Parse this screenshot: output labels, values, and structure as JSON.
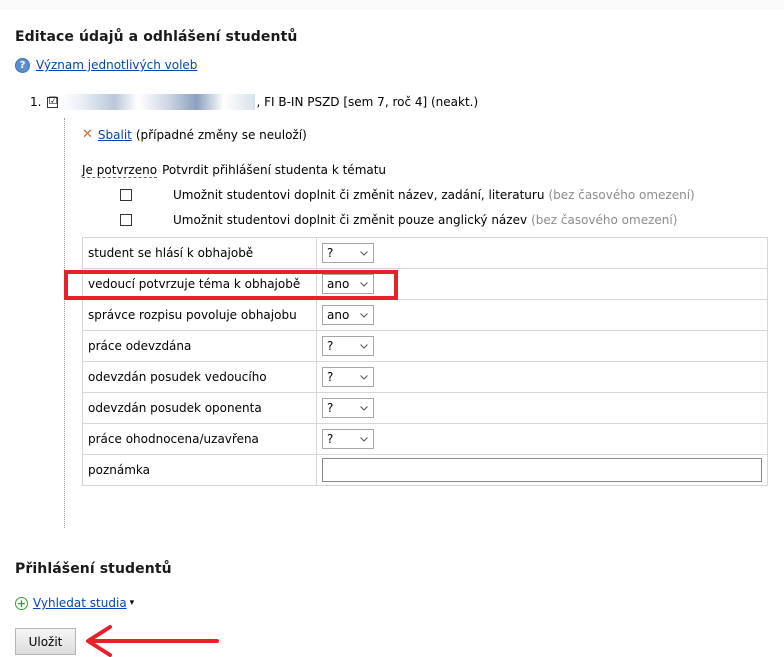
{
  "heading": "Editace údajů a odhlášení studentů",
  "help": {
    "icon": "help-icon",
    "link": "Význam jednotlivých voleb"
  },
  "student": {
    "number": "1.",
    "checked_mark": "☑",
    "info": ", FI B-IN PSZD [sem 7, roč 4] (neakt.)"
  },
  "collapse": {
    "icon": "x-icon",
    "link": "Sbalit",
    "note": "(případné změny se neuloží)"
  },
  "confirm": {
    "label": "Je potvrzeno",
    "text": "Potvrdit přihlášení studenta k tématu"
  },
  "options": [
    {
      "text": "Umožnit studentovi doplnit či změnit název, zadání, literaturu",
      "hint": "(bez časového omezení)"
    },
    {
      "text": "Umožnit studentovi doplnit či změnit pouze anglický název",
      "hint": "(bez časového omezení)"
    }
  ],
  "rows": [
    {
      "label": "student se hlásí k obhajobě",
      "value": "?"
    },
    {
      "label": "vedoucí potvrzuje téma k obhajobě",
      "value": "ano"
    },
    {
      "label": "správce rozpisu povoluje obhajobu",
      "value": "ano"
    },
    {
      "label": "práce odevzdána",
      "value": "?"
    },
    {
      "label": "odevzdán posudek vedoucího",
      "value": "?"
    },
    {
      "label": "odevzdán posudek oponenta",
      "value": "?"
    },
    {
      "label": "práce ohodnocena/uzavřena",
      "value": "?"
    },
    {
      "label": "poznámka",
      "value": ""
    }
  ],
  "section2": "Přihlášení studentů",
  "search": {
    "icon": "plus-icon",
    "link": "Vyhledat studia",
    "caret": "▾"
  },
  "save": "Uložit",
  "colors": {
    "link": "#0645ad",
    "highlight": "#e8202a",
    "hint": "#8c8c8c"
  }
}
